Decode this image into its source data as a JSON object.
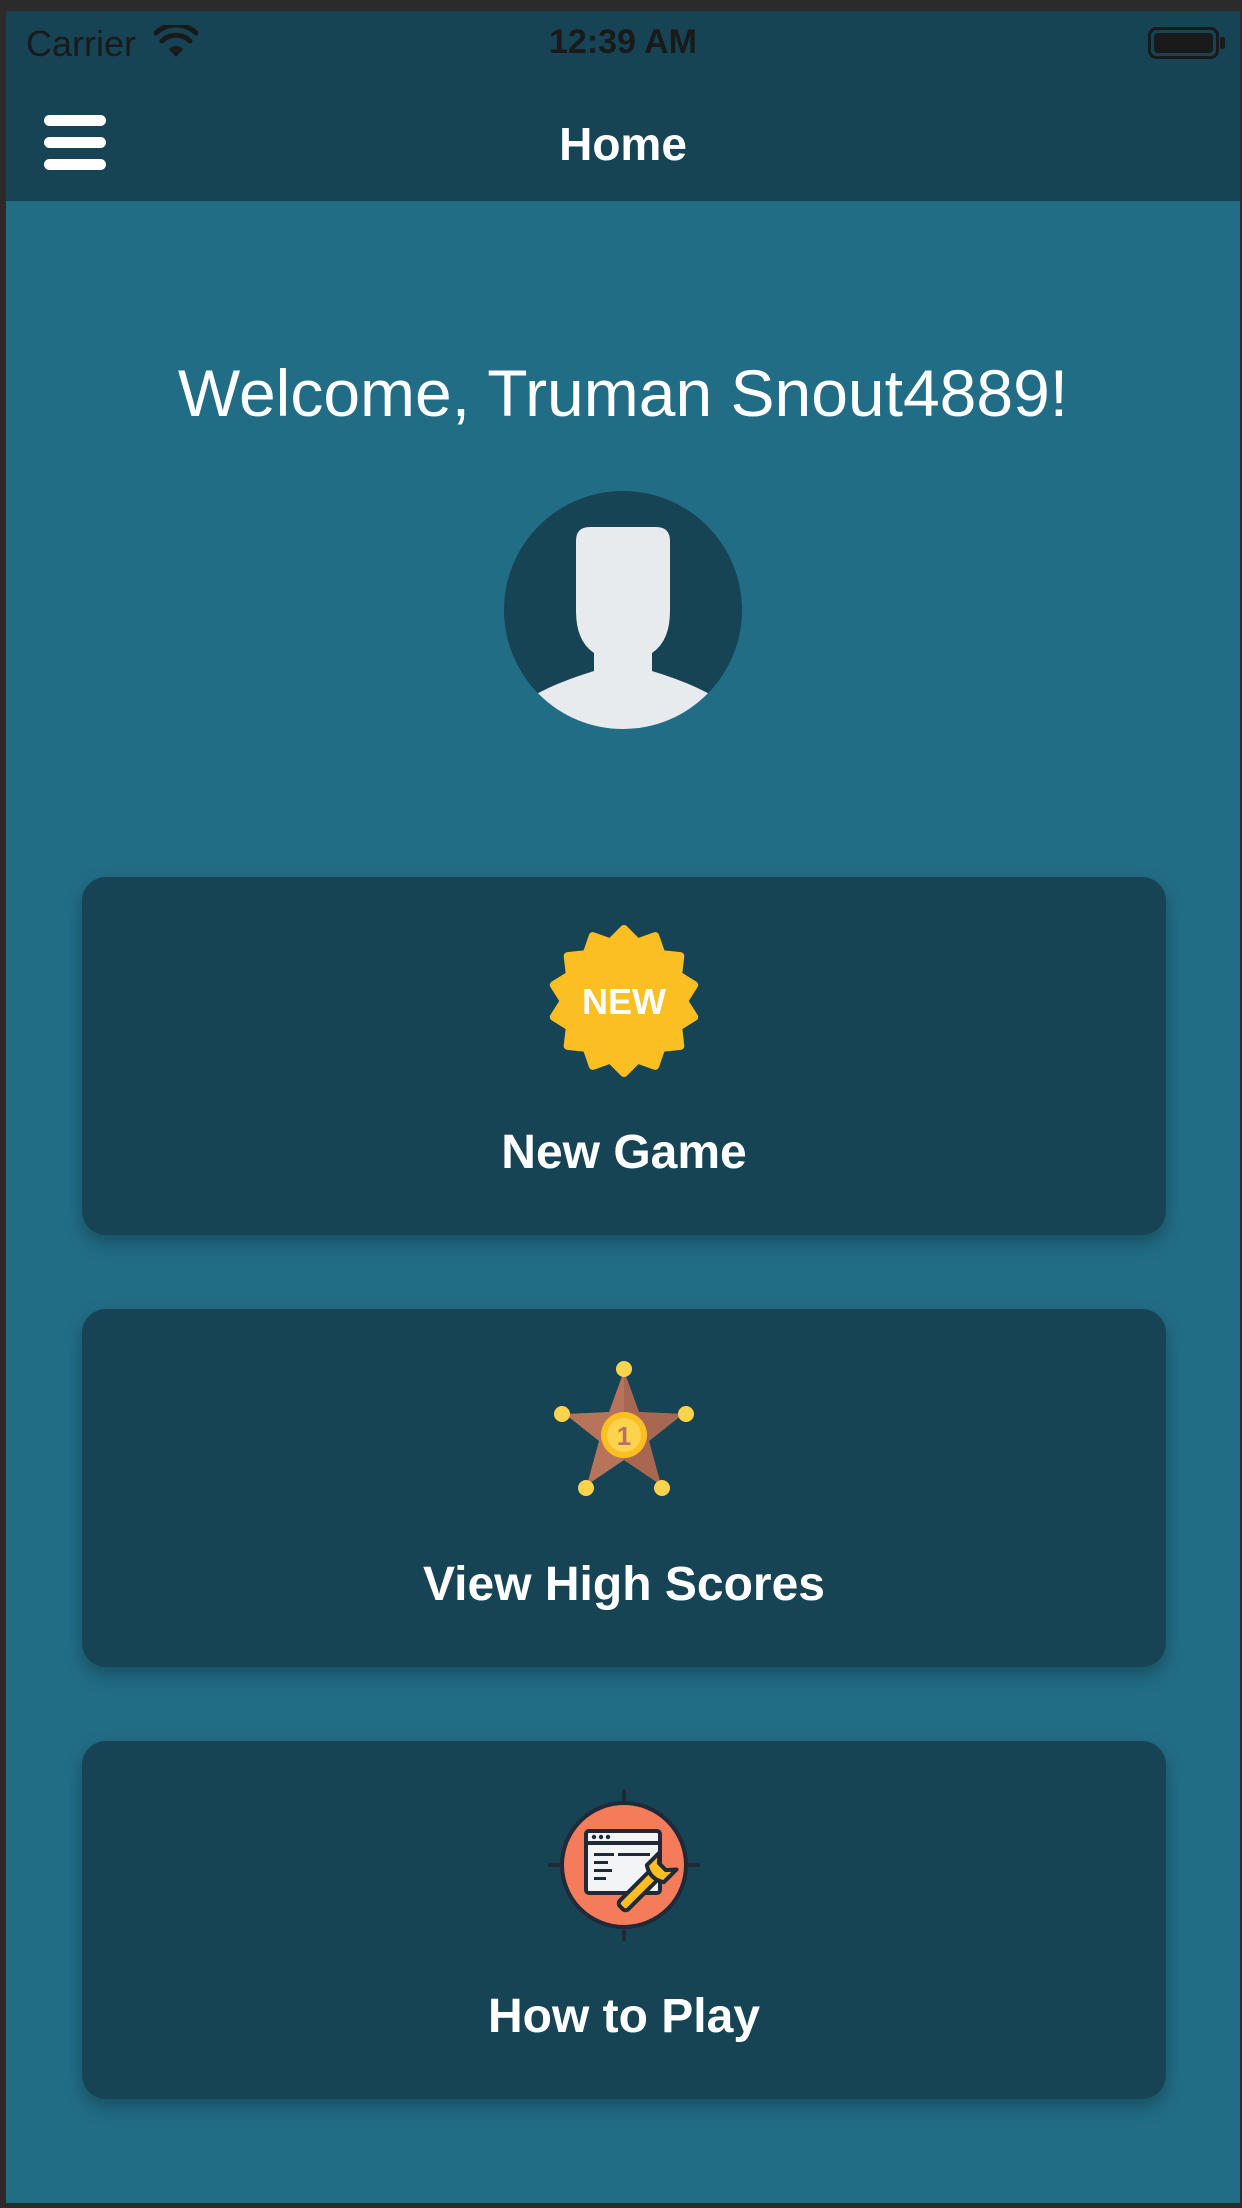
{
  "status_bar": {
    "carrier": "Carrier",
    "time": "12:39 AM"
  },
  "nav": {
    "title": "Home",
    "menu_icon": "hamburger-menu-icon"
  },
  "welcome_text": "Welcome, Truman Snout4889!",
  "avatar_icon": "user-silhouette-icon",
  "menu": [
    {
      "label": "New Game",
      "icon": "new-badge-icon",
      "badge_text": "NEW"
    },
    {
      "label": "View High Scores",
      "icon": "star-medal-icon",
      "badge_text": "1"
    },
    {
      "label": "How to Play",
      "icon": "browser-wrench-icon"
    }
  ],
  "colors": {
    "background": "#226d86",
    "bar": "#164454",
    "card": "#164454",
    "badge_yellow": "#fbbf24",
    "star_brown": "#b8745a",
    "howto_orange": "#f47c5a"
  }
}
